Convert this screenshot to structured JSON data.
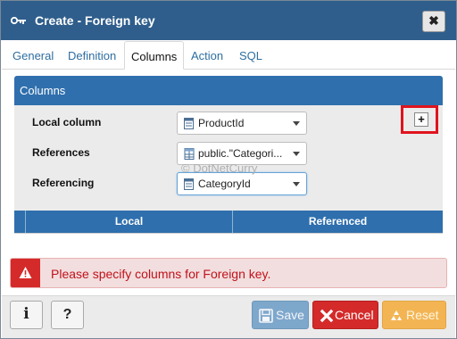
{
  "dialog": {
    "title": "Create - Foreign key",
    "close_label": "✖"
  },
  "tabs": [
    "General",
    "Definition",
    "Columns",
    "Action",
    "SQL"
  ],
  "active_tab": "Columns",
  "columns_panel": {
    "title": "Columns",
    "add_label": "+",
    "fields": {
      "local_column": {
        "label": "Local column",
        "value": "ProductId"
      },
      "references": {
        "label": "References",
        "value": "public.\"Categori..."
      },
      "referencing": {
        "label": "Referencing",
        "value": "CategoryId"
      }
    },
    "grid_headers": {
      "local": "Local",
      "referenced": "Referenced"
    },
    "watermark": "© DotNetCurry"
  },
  "error": {
    "message": "Please specify columns for Foreign key."
  },
  "footer": {
    "info_label": "i",
    "help_label": "?",
    "save_label": "Save",
    "cancel_label": "Cancel",
    "reset_label": "Reset"
  },
  "colors": {
    "titlebar": "#2f5e8c",
    "panel_header": "#2f6fad",
    "error_text": "#c1121b",
    "highlight": "#e0141e",
    "save": "#7ea7cc",
    "cancel": "#d42a2a",
    "reset": "#f3b554"
  },
  "icons": [
    "key-icon",
    "close-icon",
    "plus-icon",
    "column-icon",
    "table-icon",
    "warning-icon",
    "info-icon",
    "help-icon",
    "save-icon",
    "cancel-icon",
    "reset-icon"
  ]
}
